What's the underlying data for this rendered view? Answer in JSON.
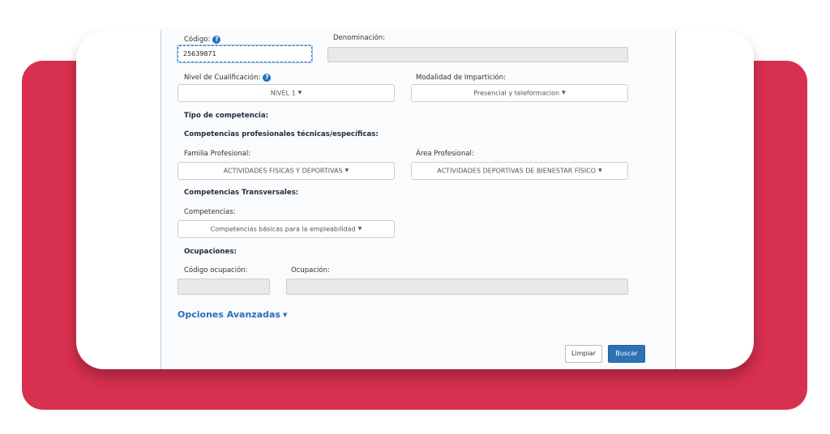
{
  "form": {
    "codigo_label": "Código:",
    "codigo_value": "25639871",
    "denominacion_label": "Denominación:",
    "denominacion_value": "",
    "nivel_label": "Nivel de Cualificación:",
    "nivel_value": "NIVEL 1",
    "modalidad_label": "Modalidad de Impartición:",
    "modalidad_value": "Presencial y teleformacion",
    "tipo_competencia": "Tipo de competencia:",
    "competencias_prof": "Competencias profesionales técnicas/específicas:",
    "familia_label": "Familia Profesional:",
    "familia_value": "ACTIVIDADES FISICAS Y DEPORTIVAS",
    "area_label": "Área Profesional:",
    "area_value": "ACTIVIDADES DEPORTIVAS DE BIENESTAR FÍSICO",
    "comp_transversales": "Competencias Transversales:",
    "competencias_label": "Competencias:",
    "competencias_value": "Competencias básicas para la empleabilidad",
    "ocupaciones": "Ocupaciones:",
    "codigo_ocupacion_label": "Código ocupación:",
    "codigo_ocupacion_value": "",
    "ocupacion_label": "Ocupación:",
    "ocupacion_value": "",
    "opciones_avanzadas": "Opciones Avanzadas",
    "limpiar": "Limpiar",
    "buscar": "Buscar",
    "help_glyph": "?",
    "caret_glyph": "▼"
  },
  "icons": [
    "help-icon",
    "caret-down-icon"
  ],
  "colors": {
    "accent_red": "#d8304f",
    "primary_blue": "#2f73b5",
    "link_blue": "#2a6ebb",
    "help_blue": "#1f6fc6"
  }
}
